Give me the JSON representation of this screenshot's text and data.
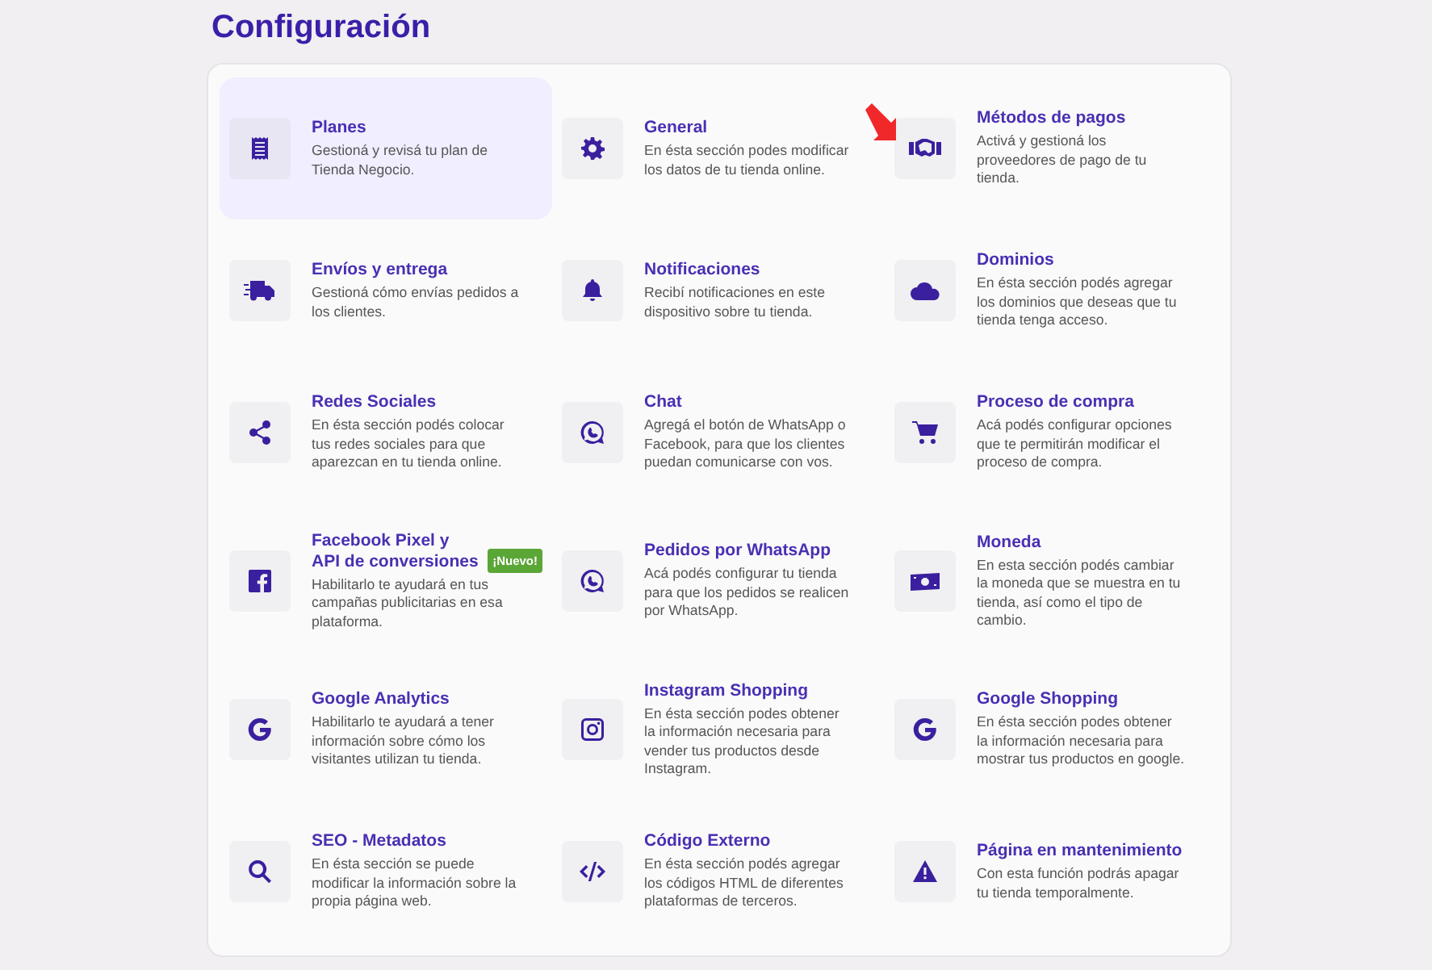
{
  "title": "Configuración",
  "items": [
    {
      "title": "Planes",
      "description": "Gestioná y revisá tu plan de Tienda Negocio.",
      "selected": true,
      "pointer": false
    },
    {
      "title": "General",
      "description": "En ésta sección podes modificar los datos de tu tienda online.",
      "selected": false,
      "pointer": false
    },
    {
      "title": "Métodos de pagos",
      "description": "Activá y gestioná los proveedores de pago de tu tienda.",
      "selected": false,
      "pointer": true
    },
    {
      "title": "Envíos y entrega",
      "description": "Gestioná cómo envías pedidos a los clientes.",
      "selected": false,
      "pointer": false
    },
    {
      "title": "Notificaciones",
      "description": "Recibí notificaciones en este dispositivo sobre tu tienda.",
      "selected": false,
      "pointer": false
    },
    {
      "title": "Dominios",
      "description": "En ésta sección podés agregar los dominios que deseas que tu tienda tenga acceso.",
      "selected": false,
      "pointer": false
    },
    {
      "title": "Redes Sociales",
      "description": "En ésta sección podés colocar tus redes sociales para que aparezcan en tu tienda online.",
      "selected": false,
      "pointer": false
    },
    {
      "title": "Chat",
      "description": "Agregá el botón de WhatsApp o Facebook, para que los clientes puedan comunicarse con vos.",
      "selected": false,
      "pointer": false
    },
    {
      "title": "Proceso de compra",
      "description": "Acá podés configurar opciones que te permitirán modificar el proceso de compra.",
      "selected": false,
      "pointer": false
    },
    {
      "title": "Facebook Pixel y API de conversiones",
      "badge": "¡Nuevo!",
      "description": "Habilitarlo te ayudará en tus campañas publicitarias en esa plataforma.",
      "selected": false,
      "pointer": false
    },
    {
      "title": "Pedidos por WhatsApp",
      "description": "Acá podés configurar tu tienda para que los pedidos se realicen por WhatsApp.",
      "selected": false,
      "pointer": false
    },
    {
      "title": "Moneda",
      "description": "En esta sección podés cambiar la moneda que se muestra en tu tienda, así como el tipo de cambio.",
      "selected": false,
      "pointer": false
    },
    {
      "title": "Google Analytics",
      "description": "Habilitarlo te ayudará a tener información sobre cómo los visitantes utilizan tu tienda.",
      "selected": false,
      "pointer": false
    },
    {
      "title": "Instagram Shopping",
      "description": "En ésta sección podes obtener la información necesaria para vender tus productos desde Instagram.",
      "selected": false,
      "pointer": false
    },
    {
      "title": "Google Shopping",
      "description": "En ésta sección podes obtener la información necesaria para mostrar tus productos en google.",
      "selected": false,
      "pointer": false
    },
    {
      "title": "SEO - Metadatos",
      "description": "En ésta sección se puede modificar la información sobre la propia página web.",
      "selected": false,
      "pointer": false
    },
    {
      "title": "Código Externo",
      "description": "En ésta sección podés agregar los códigos HTML de diferentes plataformas de terceros.",
      "selected": false,
      "pointer": false
    },
    {
      "title": "Página en mantenimiento",
      "description": "Con esta función podrás apagar tu tienda temporalmente.",
      "selected": false,
      "pointer": false
    }
  ]
}
